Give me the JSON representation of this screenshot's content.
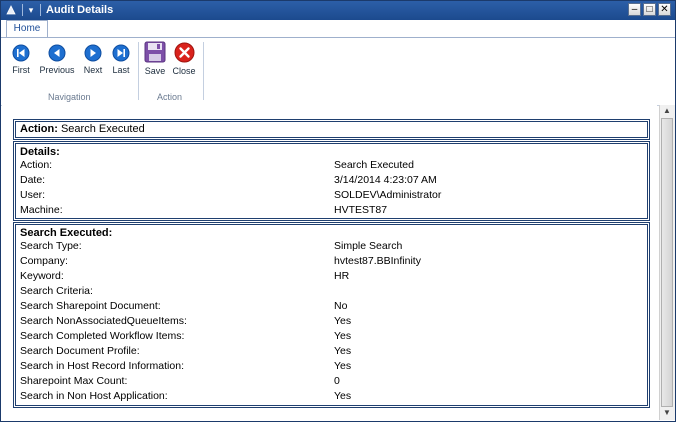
{
  "window": {
    "title": "Audit Details"
  },
  "ribbon": {
    "tab": "Home",
    "navigation": {
      "label": "Navigation",
      "buttons": [
        "First",
        "Previous",
        "Next",
        "Last"
      ]
    },
    "action": {
      "label": "Action",
      "buttons": [
        "Save",
        "Close"
      ]
    }
  },
  "action_box": {
    "label": "Action:",
    "value": "Search Executed"
  },
  "details": {
    "title": "Details:",
    "rows": [
      {
        "key": "Action:",
        "value": "Search Executed"
      },
      {
        "key": "Date:",
        "value": "3/14/2014 4:23:07 AM"
      },
      {
        "key": "User:",
        "value": "SOLDEV\\Administrator"
      },
      {
        "key": "Machine:",
        "value": "HVTEST87"
      }
    ]
  },
  "search": {
    "title": "Search Executed:",
    "rows": [
      {
        "key": "Search Type:",
        "value": "Simple Search"
      },
      {
        "key": "Company:",
        "value": "hvtest87.BBInfinity"
      },
      {
        "key": "Keyword:",
        "value": "HR"
      },
      {
        "key": "Search Criteria:",
        "value": ""
      },
      {
        "key": "Search Sharepoint Document:",
        "value": "No"
      },
      {
        "key": "Search NonAssociatedQueueItems:",
        "value": "Yes"
      },
      {
        "key": "Search Completed Workflow Items:",
        "value": "Yes"
      },
      {
        "key": "Search Document Profile:",
        "value": "Yes"
      },
      {
        "key": "Search in Host Record Information:",
        "value": "Yes"
      },
      {
        "key": "Sharepoint Max Count:",
        "value": "0"
      },
      {
        "key": "Search in Non Host Application:",
        "value": "Yes"
      }
    ]
  },
  "colors": {
    "titlebar": "#1c4a8e",
    "nav_button": "#1e6fd0",
    "close_button": "#d9221c",
    "save_icon": "#7d4fa8",
    "box_border": "#1f3f6f"
  }
}
